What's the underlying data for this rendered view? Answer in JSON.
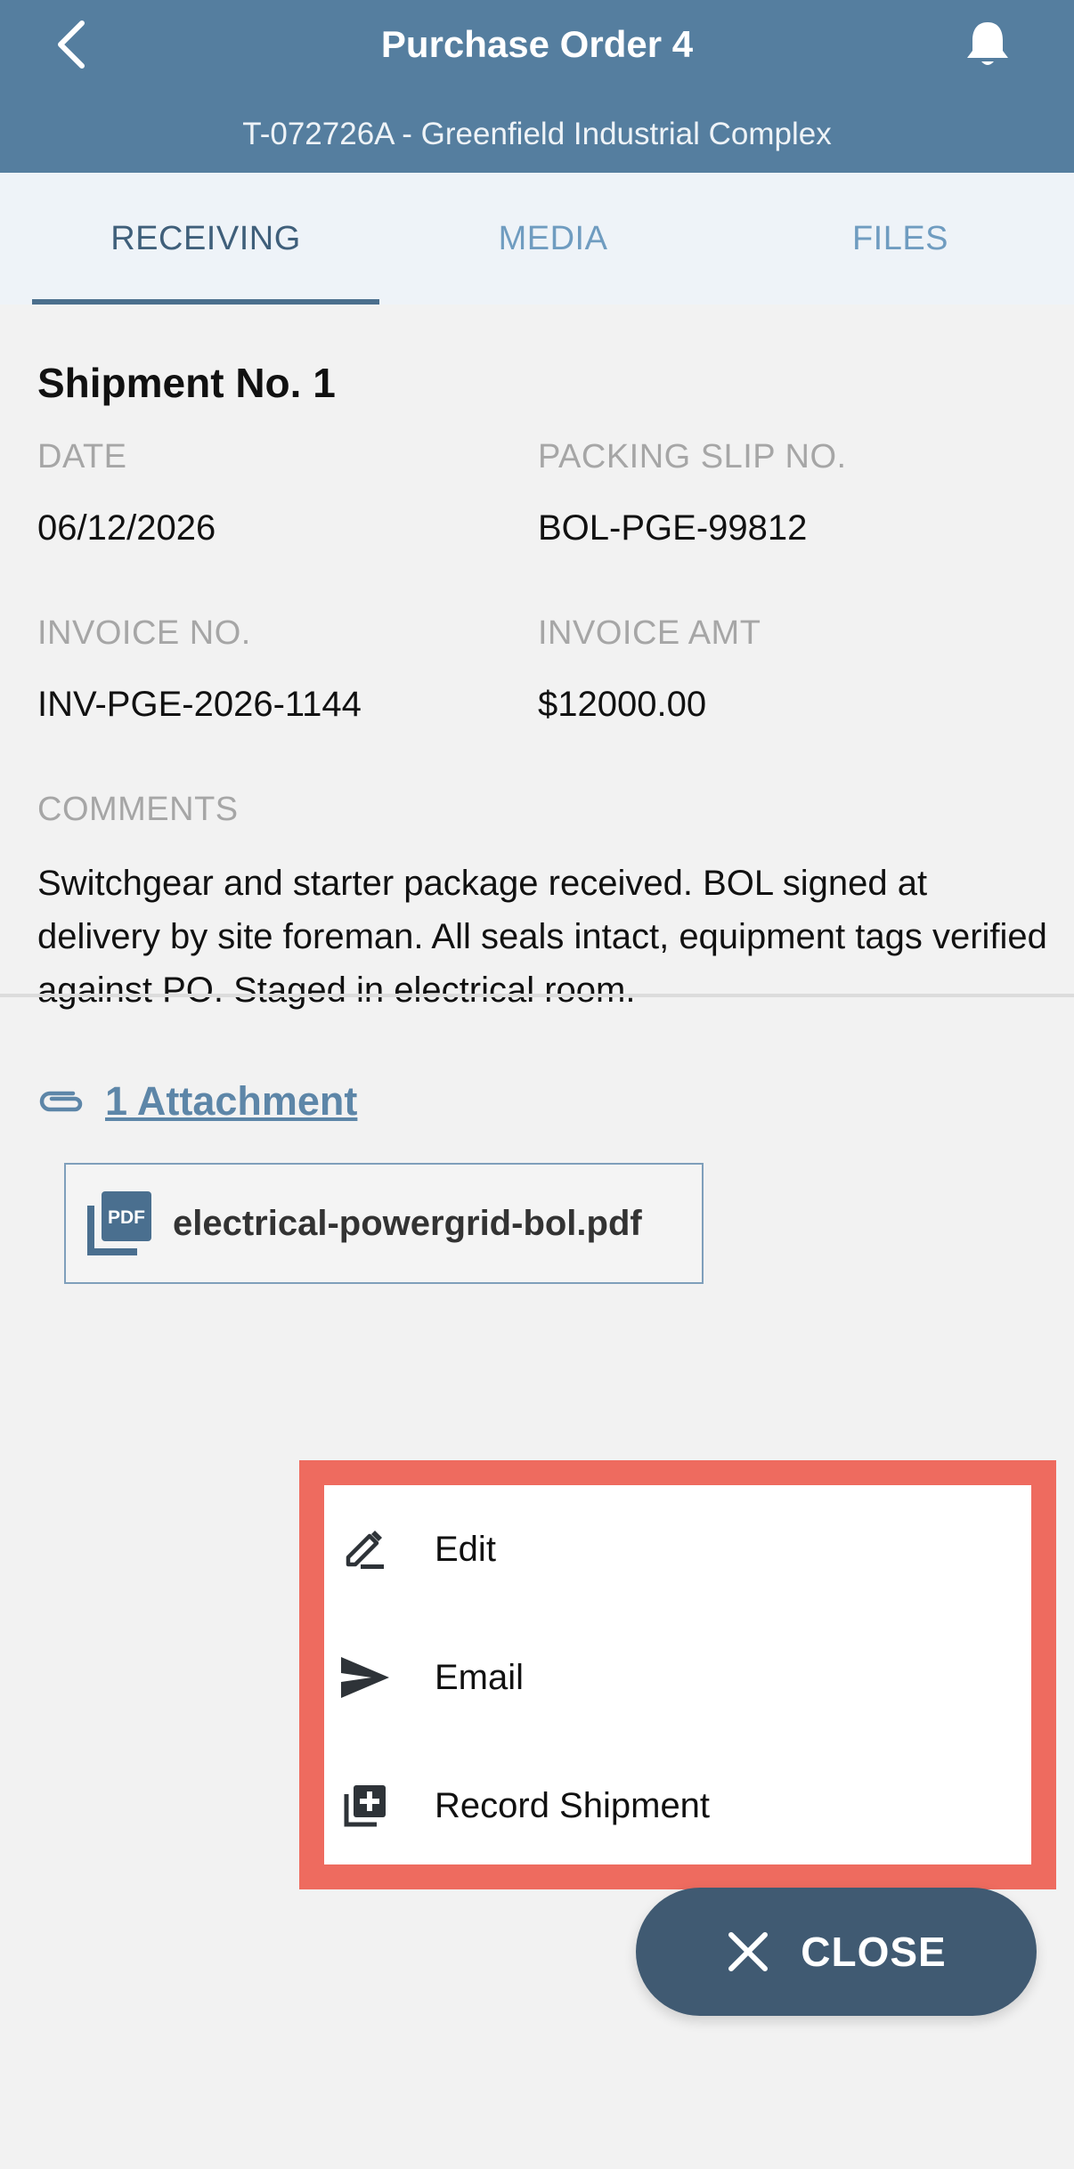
{
  "header": {
    "title": "Purchase Order 4",
    "subtitle": "T-072726A - Greenfield Industrial Complex"
  },
  "tabs": [
    {
      "label": "RECEIVING",
      "active": true
    },
    {
      "label": "MEDIA",
      "active": false
    },
    {
      "label": "FILES",
      "active": false
    }
  ],
  "shipment": {
    "title": "Shipment No. 1",
    "date_label": "DATE",
    "date_value": "06/12/2026",
    "packing_label": "PACKING SLIP NO.",
    "packing_value": "BOL-PGE-99812",
    "invoice_no_label": "INVOICE NO.",
    "invoice_no_value": "INV-PGE-2026-1144",
    "invoice_amt_label": "INVOICE AMT",
    "invoice_amt_value": "$12000.00",
    "comments_label": "COMMENTS",
    "comments_value": "Switchgear and starter package received. BOL signed at delivery by site foreman. All seals intact, equipment tags verified against PO. Staged in electrical room."
  },
  "attachments": {
    "link_label": "1 Attachment",
    "files": [
      {
        "name": "electrical-powergrid-bol.pdf",
        "icon": "pdf-file-icon"
      }
    ]
  },
  "menu": {
    "items": [
      {
        "label": "Edit",
        "icon": "edit-pen-icon"
      },
      {
        "label": "Email",
        "icon": "send-icon"
      },
      {
        "label": "Record Shipment",
        "icon": "add-library-icon"
      }
    ]
  },
  "fab": {
    "label": "CLOSE",
    "icon": "close-icon"
  },
  "colors": {
    "header_bg": "#557e9f",
    "tab_bg": "#eef3f8",
    "accent": "#5d86a8",
    "highlight": "#ee6b5f",
    "fab_bg": "#405a72"
  }
}
